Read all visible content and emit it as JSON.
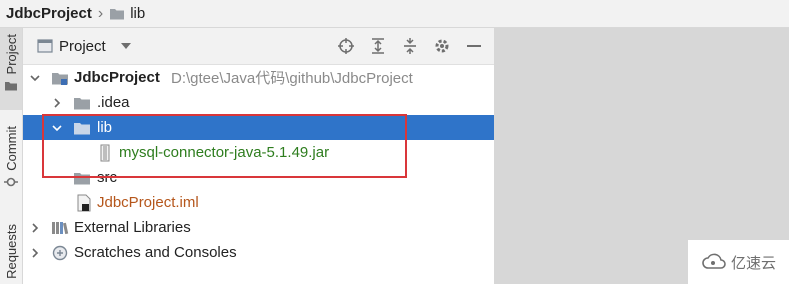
{
  "breadcrumb": {
    "project": "JdbcProject",
    "folder": "lib"
  },
  "left_tabs": {
    "project": "Project",
    "commit": "Commit",
    "requests": "Requests"
  },
  "panel": {
    "title": "Project",
    "icons": [
      "crosshair-icon",
      "expand-all-icon",
      "collapse-all-icon",
      "gear-icon",
      "minimize-icon"
    ]
  },
  "tree": {
    "root_name": "JdbcProject",
    "root_path": "D:\\gtee\\Java代码\\github\\JdbcProject",
    "idea": ".idea",
    "lib": "lib",
    "jar": "mysql-connector-java-5.1.49.jar",
    "src": "src",
    "iml": "JdbcProject.iml",
    "external": "External Libraries",
    "scratches": "Scratches and Consoles"
  },
  "colors": {
    "selection": "#2f74c9",
    "jar_text": "#2e7d1e",
    "iml_text": "#b5561b",
    "highlight_border": "#d9363a"
  },
  "watermark": {
    "text": "亿速云"
  }
}
